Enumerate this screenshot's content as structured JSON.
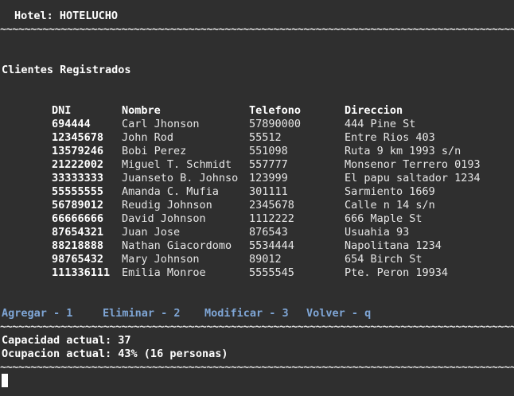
{
  "hotel_title": "Hotel: HOTELUCHO",
  "separator": "~~~~~~~~~~~~~~~~~~~~~~~~~~~~~~~~~~~~~~~~~~~~~~~~~~~~~~~~~~~~~~~~~~~~~~~~~~~~~~~~~~~~~~~~~~~~~~~~~~~~~~~~~~",
  "section_title": "Clientes Registrados",
  "table": {
    "headers": {
      "dni": "DNI",
      "nombre": "Nombre",
      "telefono": "Telefono",
      "direccion": "Direccion"
    },
    "rows": [
      {
        "dni": "694444",
        "nombre": "Carl Jhonson",
        "telefono": "57890000",
        "direccion": "444 Pine St"
      },
      {
        "dni": "12345678",
        "nombre": "John Rod",
        "telefono": "55512",
        "direccion": "Entre Rios 403"
      },
      {
        "dni": "13579246",
        "nombre": "Bobi Perez",
        "telefono": "551098",
        "direccion": "Ruta 9 km 1993 s/n"
      },
      {
        "dni": "21222002",
        "nombre": "Miguel T. Schmidt",
        "telefono": "557777",
        "direccion": "Monsenor Terrero 0193"
      },
      {
        "dni": "33333333",
        "nombre": "Juanseto B. Johnso",
        "telefono": "123999",
        "direccion": "El papu saltador 1234"
      },
      {
        "dni": "55555555",
        "nombre": "Amanda C. Mufia",
        "telefono": "301111",
        "direccion": "Sarmiento 1669"
      },
      {
        "dni": "56789012",
        "nombre": "Reudig Johnson",
        "telefono": "2345678",
        "direccion": "Calle n 14 s/n"
      },
      {
        "dni": "66666666",
        "nombre": "David Johnson",
        "telefono": "1112222",
        "direccion": "666 Maple St"
      },
      {
        "dni": "87654321",
        "nombre": "Juan Jose",
        "telefono": "876543",
        "direccion": "Usuahia 93"
      },
      {
        "dni": "88218888",
        "nombre": "Nathan Giacordomo",
        "telefono": "5534444",
        "direccion": "Napolitana 1234"
      },
      {
        "dni": "98765432",
        "nombre": "Mary Johnson",
        "telefono": "89012",
        "direccion": "654 Birch St"
      },
      {
        "dni": "111336111",
        "nombre": "Emilia Monroe",
        "telefono": "5555545",
        "direccion": "Pte. Peron 19934"
      }
    ]
  },
  "menu": {
    "agregar": "Agregar - 1",
    "eliminar": "Eliminar - 2",
    "modificar": "Modificar - 3",
    "volver": "Volver - q"
  },
  "status": {
    "capacidad": "Capacidad actual: 37",
    "ocupacion": "Ocupacion actual: 43% (16 personas)"
  },
  "colors": {
    "background": "#2f2f2f",
    "text": "#e6e6e6",
    "menu": "#7fa6d6"
  }
}
